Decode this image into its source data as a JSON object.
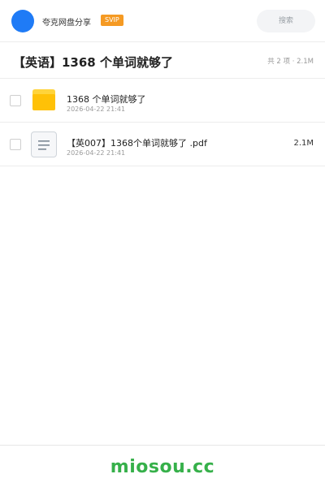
{
  "header": {
    "brand": "夸克网盘分享",
    "vip_badge": "SVIP",
    "search_label": "搜索",
    "avatar_color": "#1f7bf6"
  },
  "share": {
    "title": "【英语】1368 个单词就够了",
    "meta": "共 2 项 · 2.1M"
  },
  "files": [
    {
      "icon": "folder-icon",
      "name": "1368 个单词就够了",
      "date": "2026-04-22 21:41",
      "size": ""
    },
    {
      "icon": "document-icon",
      "name": "【英007】1368个单词就够了 .pdf",
      "date": "2026-04-22 21:41",
      "size": "2.1M"
    }
  ],
  "footer": {
    "logo_text": "miosou.cc",
    "logo_color": "#36b04a"
  }
}
